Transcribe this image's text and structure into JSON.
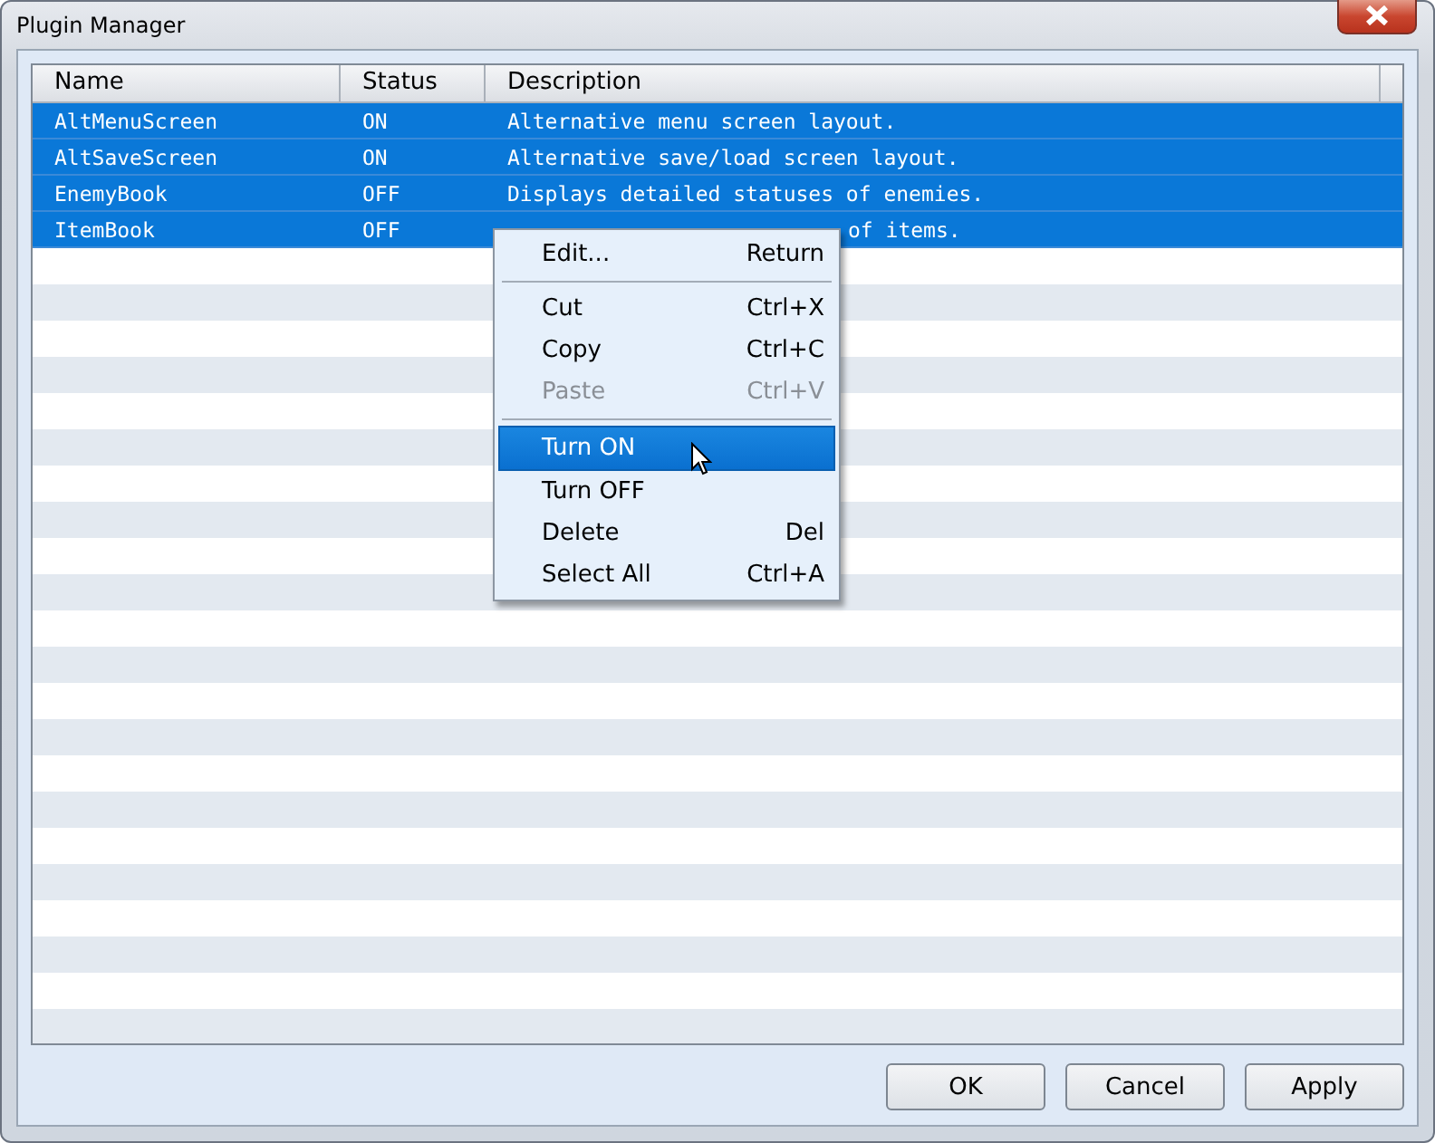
{
  "window": {
    "title": "Plugin Manager"
  },
  "table": {
    "columns": [
      "Name",
      "Status",
      "Description"
    ],
    "rows": [
      {
        "name": "AltMenuScreen",
        "status": "ON",
        "description": "Alternative menu screen layout.",
        "selected": true
      },
      {
        "name": "AltSaveScreen",
        "status": "ON",
        "description": "Alternative save/load screen layout.",
        "selected": true
      },
      {
        "name": "EnemyBook",
        "status": "OFF",
        "description": "Displays detailed statuses of enemies.",
        "selected": true
      },
      {
        "name": "ItemBook",
        "status": "OFF",
        "description": "of items.",
        "partly_covered": true,
        "selected": true
      }
    ]
  },
  "context_menu": {
    "items": [
      {
        "kind": "item",
        "label": "Edit...",
        "shortcut": "Return",
        "disabled": false,
        "selected": false
      },
      {
        "kind": "separator"
      },
      {
        "kind": "item",
        "label": "Cut",
        "shortcut": "Ctrl+X",
        "disabled": false,
        "selected": false
      },
      {
        "kind": "item",
        "label": "Copy",
        "shortcut": "Ctrl+C",
        "disabled": false,
        "selected": false
      },
      {
        "kind": "item",
        "label": "Paste",
        "shortcut": "Ctrl+V",
        "disabled": true,
        "selected": false
      },
      {
        "kind": "separator"
      },
      {
        "kind": "item",
        "label": "Turn ON",
        "disabled": false,
        "selected": true
      },
      {
        "kind": "item",
        "label": "Turn OFF",
        "disabled": false,
        "selected": false
      },
      {
        "kind": "item",
        "label": "Delete",
        "shortcut": "Del",
        "disabled": false,
        "selected": false
      },
      {
        "kind": "item",
        "label": "Select All",
        "shortcut": "Ctrl+A",
        "disabled": false,
        "selected": false
      }
    ]
  },
  "buttons": [
    "OK",
    "Cancel",
    "Apply"
  ]
}
